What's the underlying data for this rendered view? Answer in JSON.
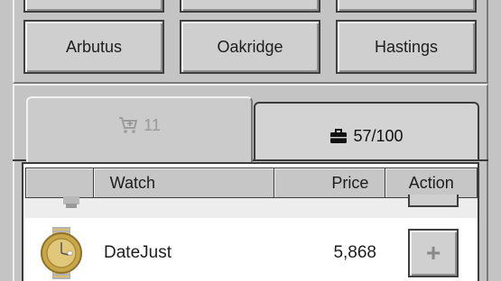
{
  "locations": {
    "top_row": [
      "",
      "",
      ""
    ],
    "row": [
      "Arbutus",
      "Oakridge",
      "Hastings"
    ]
  },
  "tabs": {
    "cart": {
      "icon": "cart-plus-icon",
      "count": "11",
      "active": false
    },
    "inventory": {
      "icon": "briefcase-icon",
      "label": "57/100",
      "active": true
    }
  },
  "table": {
    "columns": [
      "",
      "Watch",
      "Price",
      "Action"
    ],
    "rows": [
      {
        "name": "DateJust",
        "price": "5,868",
        "action_icon": "plus-icon"
      }
    ]
  },
  "colors": {
    "background": "#c4c4c4",
    "button": "#cfcfcf",
    "gold": "#c9a646"
  }
}
